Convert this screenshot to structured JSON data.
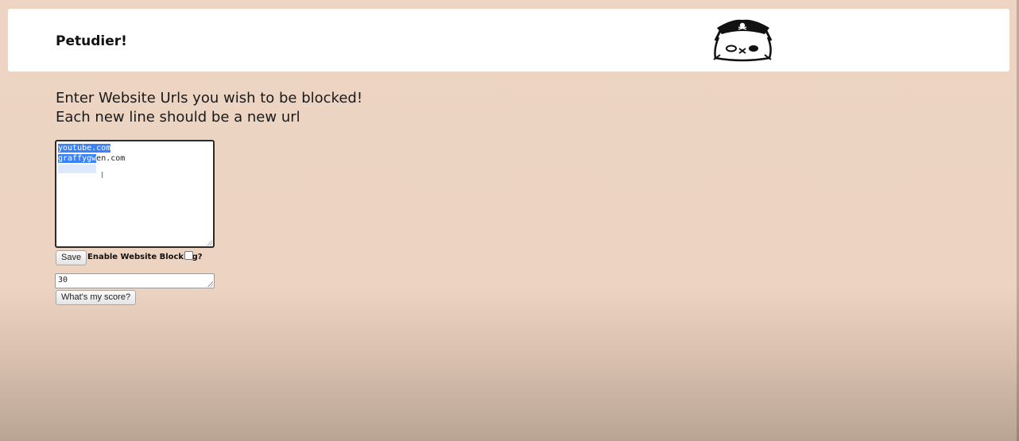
{
  "header": {
    "brand": "Petudier!",
    "mascot_icon": "pirate-cat-icon"
  },
  "instructions": {
    "line1": "Enter Website Urls you wish to be blocked!",
    "line2": "Each new line should be a new url"
  },
  "url_list": {
    "lines": [
      {
        "selected": "youtube.com",
        "rest": ""
      },
      {
        "selected": "graffygw",
        "rest": "en.com"
      }
    ]
  },
  "controls": {
    "save_label": "Save",
    "enable_label": "Enable Website Blocking?",
    "enable_checked": false,
    "score_value": "30",
    "score_button_label": "What's my score?"
  },
  "colors": {
    "background": "#edd4c3",
    "header_bg": "#ffffff",
    "selection": "#3b82f6"
  }
}
